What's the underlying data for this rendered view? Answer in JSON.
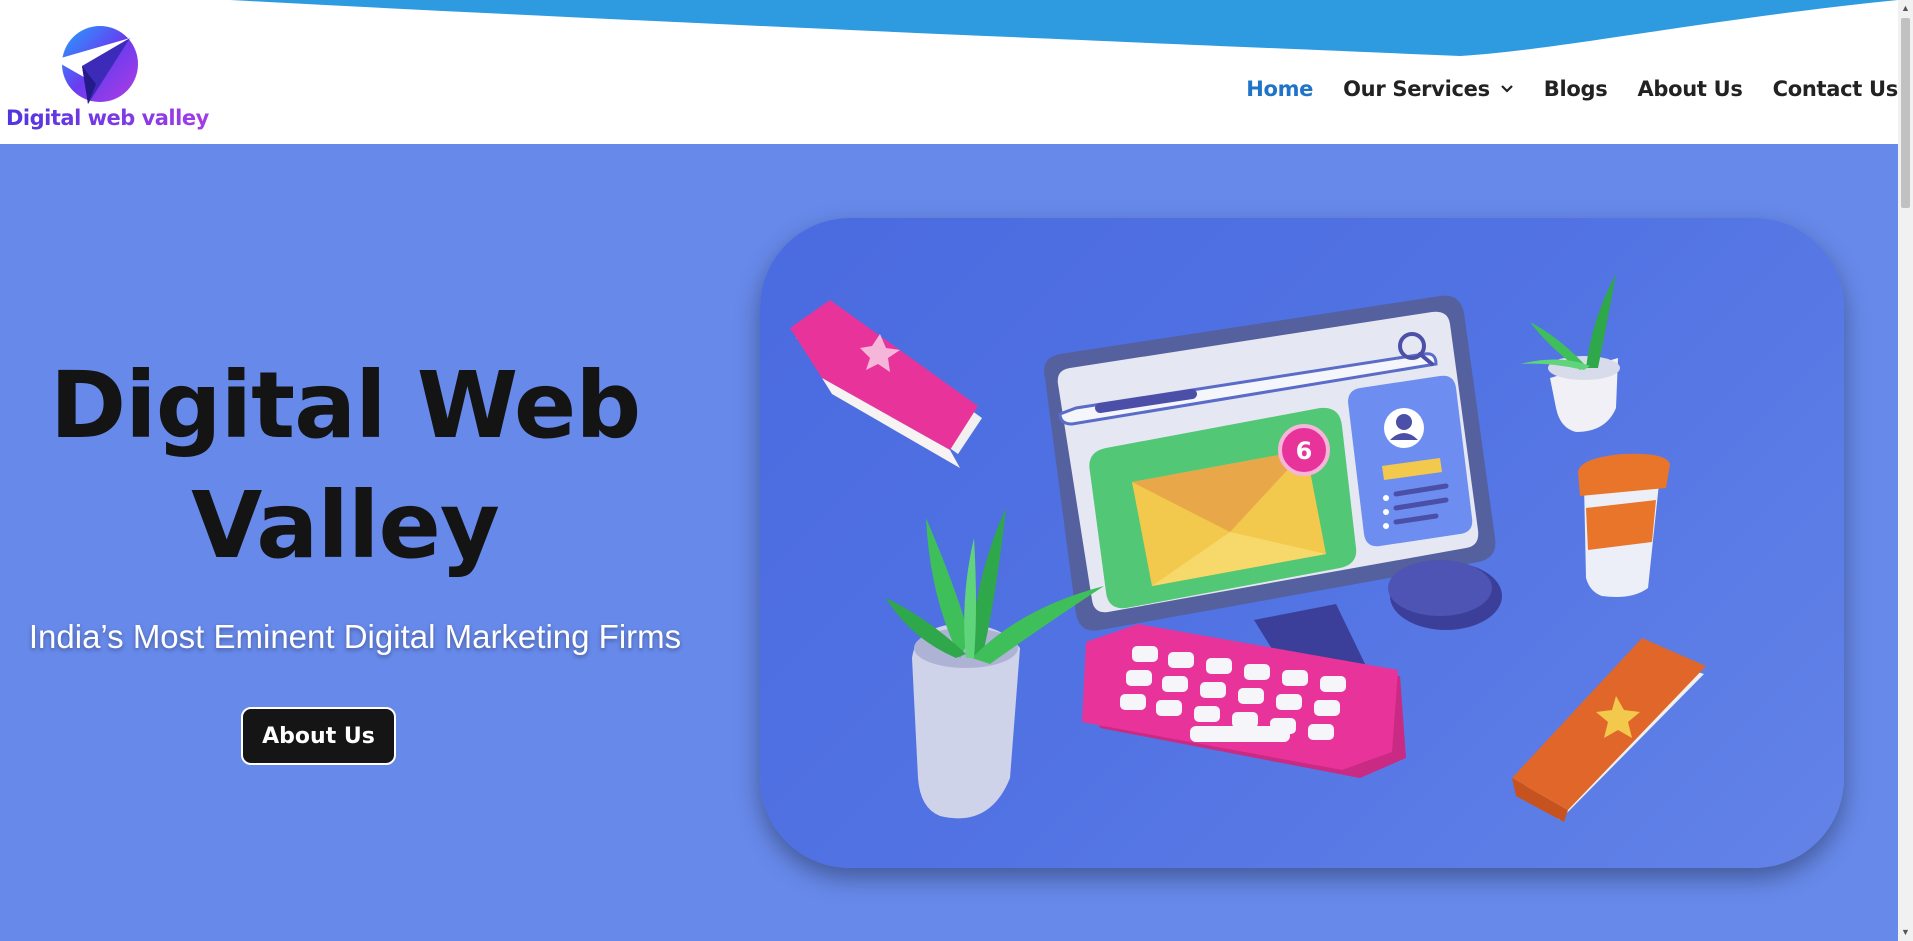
{
  "brand": {
    "name": "Digital web valley",
    "logo_icon": "paper-plane-icon"
  },
  "nav": {
    "items": [
      {
        "label": "Home",
        "active": true
      },
      {
        "label": "Our Services",
        "has_dropdown": true
      },
      {
        "label": "Blogs"
      },
      {
        "label": "About Us"
      },
      {
        "label": "Contact Us"
      }
    ]
  },
  "hero": {
    "title": "Digital Web Valley",
    "subtitle": "India’s Most Eminent Digital Marketing Firms",
    "button_label": "About Us",
    "illustration": {
      "notification_count": "6",
      "icons": [
        "computer-icon",
        "envelope-icon",
        "keyboard-icon",
        "mouse-icon",
        "plant-icon",
        "book-icon",
        "coffee-cup-icon",
        "search-icon",
        "profile-icon"
      ]
    }
  },
  "colors": {
    "hero_bg": "#6789ea",
    "nav_active": "#1f74c8",
    "wave": "#2e9be0",
    "button_bg": "#151515"
  }
}
